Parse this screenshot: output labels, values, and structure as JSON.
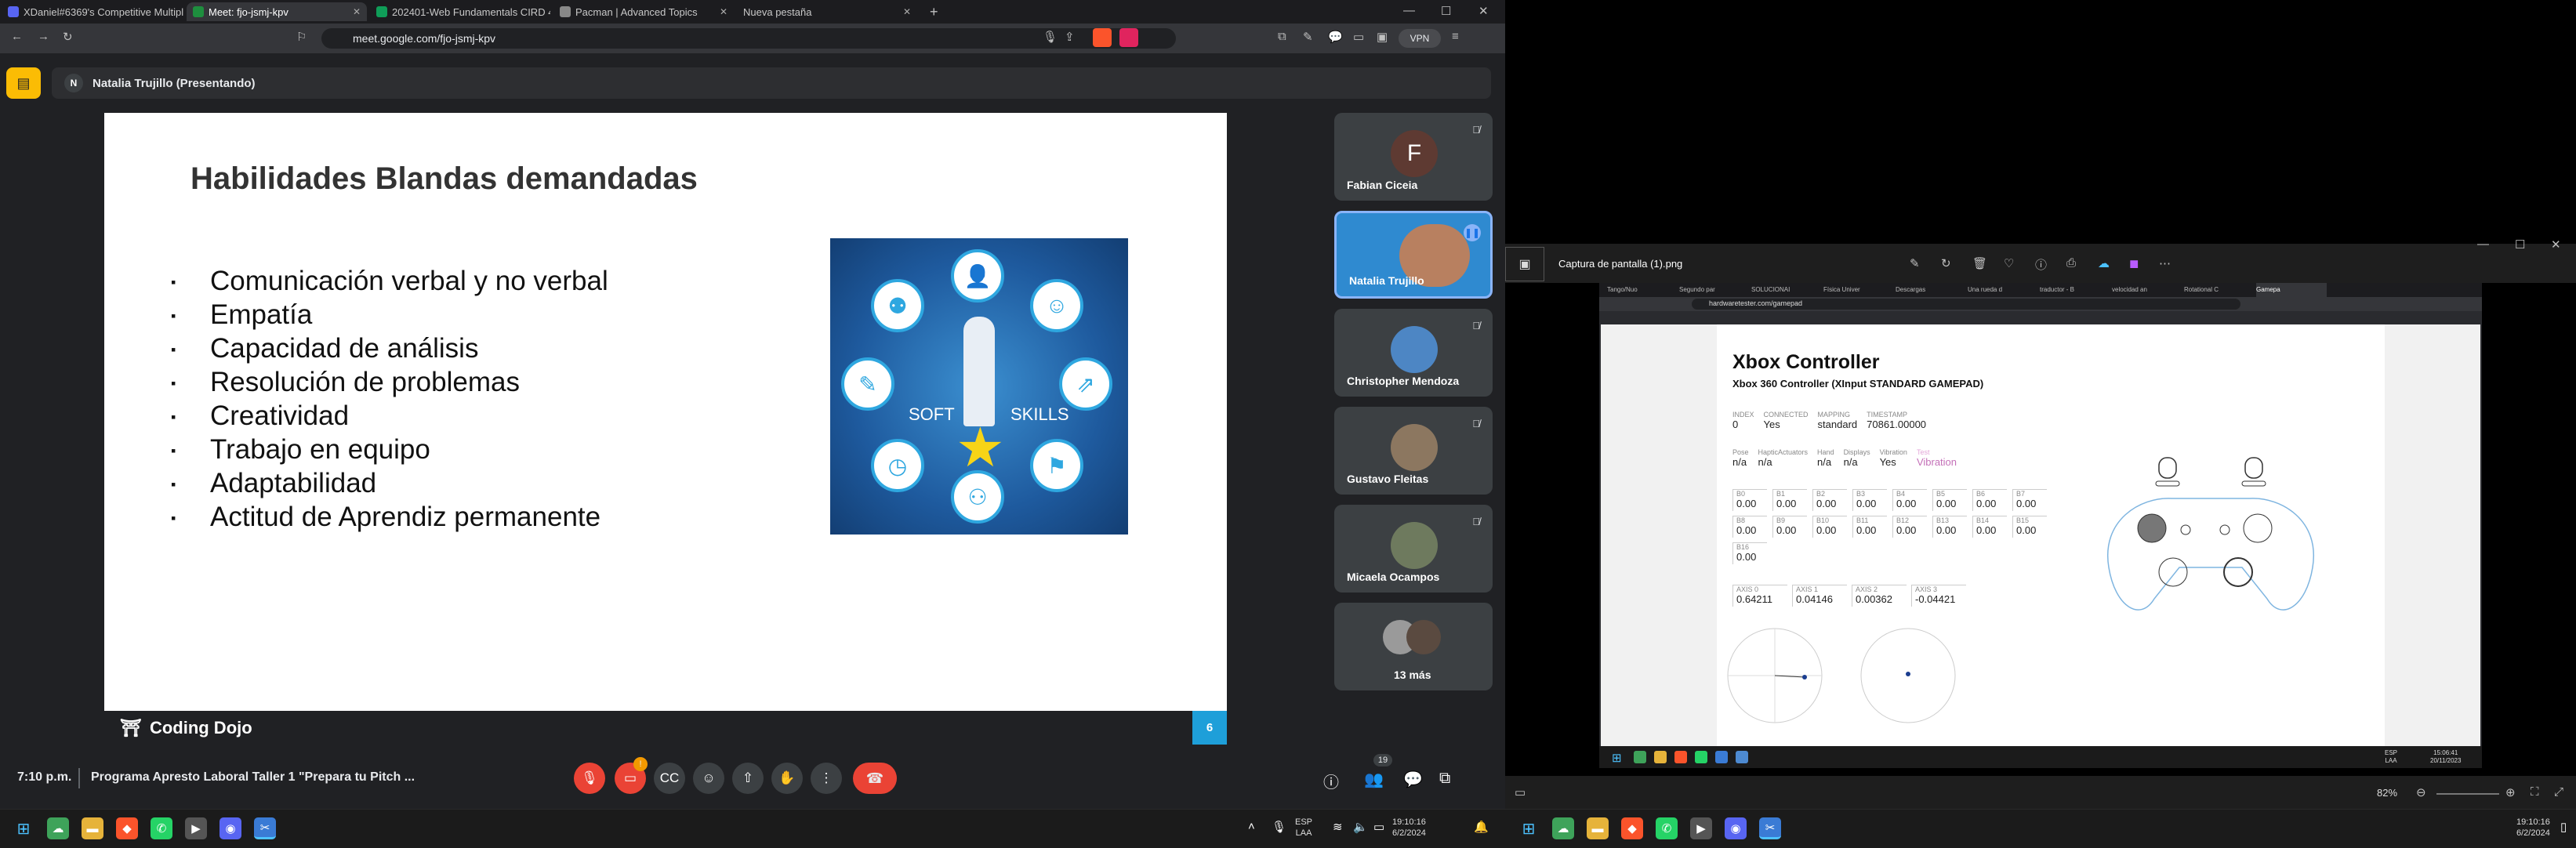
{
  "left": {
    "tabs": [
      {
        "label": "XDaniel#6369's Competitive Multiplay",
        "color": "#5865f2"
      },
      {
        "label": "Meet: fjo-jsmj-kpv",
        "color": "#1e8e3e",
        "active": true
      },
      {
        "label": "202401-Web Fundamentals CIRD 4 Fi",
        "color": "#0f9d58"
      },
      {
        "label": "Pacman | Advanced Topics",
        "color": "#888888"
      },
      {
        "label": "Nueva pestaña",
        "color": "#555555"
      }
    ],
    "url": "meet.google.com/fjo-jsmj-kpv",
    "vpn": "VPN",
    "presenter": "Natalia Trujillo (Presentando)",
    "presenter_initial": "N",
    "slide": {
      "title": "Habilidades Blandas demandadas",
      "bullets": [
        "Comunicación verbal y no verbal",
        "Empatía",
        "Capacidad de análisis",
        "Resolución de problemas",
        "Creatividad",
        "Trabajo en equipo",
        "Adaptabilidad",
        "Actitud de Aprendiz permanente"
      ],
      "image_text_soft": "SOFT",
      "image_text_skills": "SKILLS",
      "footer": "Coding Dojo",
      "page_number": "6"
    },
    "participants": [
      {
        "name": "Fabian Ciceia",
        "initial": "F",
        "avatar_color": "#5e3a32"
      },
      {
        "name": "Natalia Trujillo",
        "avatar_color": "#2f8ad0"
      },
      {
        "name": "Christopher Mendoza",
        "avatar_color": "#4d86c4"
      },
      {
        "name": "Gustavo Fleitas",
        "avatar_color": "#8c7760"
      },
      {
        "name": "Micaela Ocampos",
        "avatar_color": "#6e7a5e"
      },
      {
        "name": "13 más",
        "avatar_color": "#6d6d6d"
      }
    ],
    "time": "7:10 p.m.",
    "meeting_title": "Programa Apresto Laboral Taller 1 \"Prepara tu Pitch ...",
    "people_count": "19",
    "taskbar": {
      "lang": "ESP",
      "region": "LAA",
      "clock": "19:10:16",
      "date": "6/2/2024"
    }
  },
  "right": {
    "filename": "Captura de pantalla (1).png",
    "inner_tabs": [
      "Tango/Nuo",
      "Segundo par",
      "SOLUCIONAI",
      "Física Univer",
      "Descargas",
      "Una rueda d",
      "traductor - B",
      "velocidad an",
      "Rotational C",
      "Gamepa"
    ],
    "inner_url": "hardwaretester.com/gamepad",
    "page": {
      "title": "Xbox Controller",
      "subtitle": "Xbox 360 Controller (XInput STANDARD GAMEPAD)",
      "info": [
        {
          "label": "INDEX",
          "value": "0"
        },
        {
          "label": "CONNECTED",
          "value": "Yes"
        },
        {
          "label": "MAPPING",
          "value": "standard"
        },
        {
          "label": "TIMESTAMP",
          "value": "70861.00000"
        }
      ],
      "info2": [
        {
          "label": "Pose",
          "value": "n/a"
        },
        {
          "label": "HapticActuators",
          "value": "n/a"
        },
        {
          "label": "Hand",
          "value": "n/a"
        },
        {
          "label": "Displays",
          "value": "n/a"
        },
        {
          "label": "Vibration",
          "value": "Yes"
        },
        {
          "label": "Test",
          "value": "Vibration"
        }
      ],
      "buttons": [
        {
          "label": "B0",
          "value": "0.00"
        },
        {
          "label": "B1",
          "value": "0.00"
        },
        {
          "label": "B2",
          "value": "0.00"
        },
        {
          "label": "B3",
          "value": "0.00"
        },
        {
          "label": "B4",
          "value": "0.00"
        },
        {
          "label": "B5",
          "value": "0.00"
        },
        {
          "label": "B6",
          "value": "0.00"
        },
        {
          "label": "B7",
          "value": "0.00"
        },
        {
          "label": "B8",
          "value": "0.00"
        },
        {
          "label": "B9",
          "value": "0.00"
        },
        {
          "label": "B10",
          "value": "0.00"
        },
        {
          "label": "B11",
          "value": "0.00"
        },
        {
          "label": "B12",
          "value": "0.00"
        },
        {
          "label": "B13",
          "value": "0.00"
        },
        {
          "label": "B14",
          "value": "0.00"
        },
        {
          "label": "B15",
          "value": "0.00"
        },
        {
          "label": "B16",
          "value": "0.00"
        }
      ],
      "axes": [
        {
          "label": "AXIS 0",
          "value": "0.64211"
        },
        {
          "label": "AXIS 1",
          "value": "0.04146"
        },
        {
          "label": "AXIS 2",
          "value": "0.00362"
        },
        {
          "label": "AXIS 3",
          "value": "-0.04421"
        }
      ]
    },
    "inner_taskbar": {
      "lang": "ESP",
      "region": "LAA",
      "clock": "15:06:41",
      "date": "20/11/2023"
    },
    "zoom": "82%",
    "taskbar": {
      "lang": "",
      "clock": "19:10:16",
      "date": "6/2/2024"
    }
  },
  "colors": {
    "meet_red": "#ea4335",
    "accent_blue": "#1e9fd9"
  }
}
